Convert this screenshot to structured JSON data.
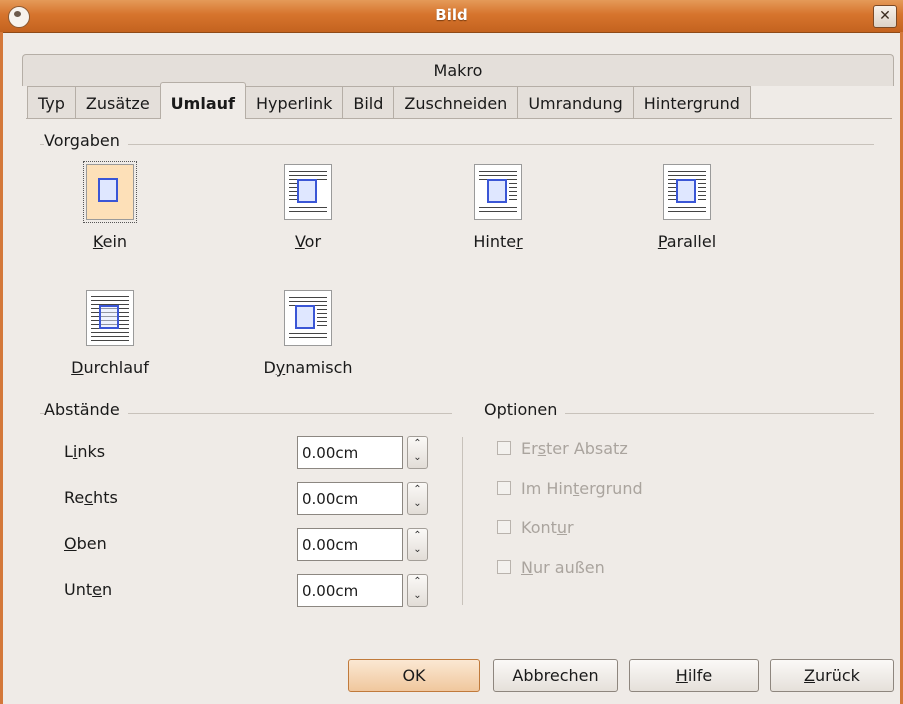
{
  "window": {
    "title": "Bild"
  },
  "tabs": {
    "row1": [
      "Makro"
    ],
    "row2": [
      "Typ",
      "Zusätze",
      "Umlauf",
      "Hyperlink",
      "Bild",
      "Zuschneiden",
      "Umrandung",
      "Hintergrund"
    ],
    "active": "Umlauf"
  },
  "presets": {
    "heading": "Vorgaben",
    "items": [
      {
        "acc": "K",
        "rest": "ein",
        "pre": ""
      },
      {
        "acc": "V",
        "rest": "or",
        "pre": ""
      },
      {
        "pre": "Hinte",
        "acc": "r",
        "rest": ""
      },
      {
        "acc": "P",
        "rest": "arallel",
        "pre": ""
      },
      {
        "acc": "D",
        "rest": "urchlauf",
        "pre": ""
      },
      {
        "pre": "D",
        "acc": "y",
        "rest": "namisch"
      }
    ],
    "selected": "Kein"
  },
  "spacing": {
    "heading": "Abstände",
    "fields": [
      {
        "pre": "L",
        "acc": "i",
        "rest": "nks",
        "value": "0.00cm"
      },
      {
        "pre": "Re",
        "acc": "c",
        "rest": "hts",
        "value": "0.00cm"
      },
      {
        "pre": "",
        "acc": "O",
        "rest": "ben",
        "value": "0.00cm"
      },
      {
        "pre": "Unt",
        "acc": "e",
        "rest": "n",
        "value": "0.00cm"
      }
    ]
  },
  "options": {
    "heading": "Optionen",
    "items": [
      {
        "pre": "Er",
        "acc": "s",
        "rest": "ter Absatz"
      },
      {
        "pre": "Im Hin",
        "acc": "t",
        "rest": "ergrund"
      },
      {
        "pre": "Kont",
        "acc": "u",
        "rest": "r"
      },
      {
        "pre": "",
        "acc": "N",
        "rest": "ur außen"
      }
    ]
  },
  "buttons": {
    "ok": "OK",
    "cancel": "Abbrechen",
    "help": {
      "acc": "H",
      "rest": "ilfe"
    },
    "back": {
      "acc": "Z",
      "rest": "urück"
    }
  },
  "colors": {
    "titlebar": "#d6742d",
    "accent": "#3a56d6"
  }
}
